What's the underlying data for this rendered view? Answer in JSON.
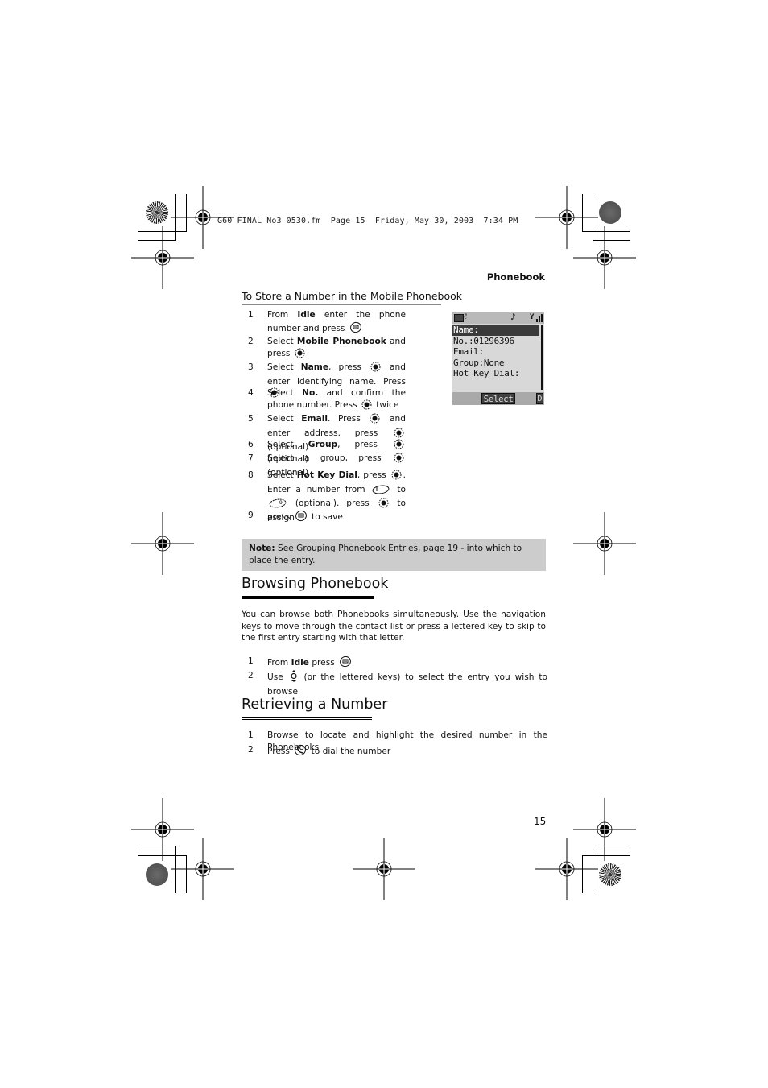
{
  "slug": "G60 FINAL No3 0530.fm  Page 15  Friday, May 30, 2003  7:34 PM",
  "running_head": "Phonebook",
  "store_section": {
    "title": "To Store a Number in the Mobile Phonebook",
    "steps": [
      {
        "num": "1",
        "parts": [
          {
            "t": "From "
          },
          {
            "b": "Idle"
          },
          {
            "t": " enter the phone number and press "
          },
          {
            "icon": "phonebook-key-icon"
          }
        ]
      },
      {
        "num": "2",
        "parts": [
          {
            "t": "Select "
          },
          {
            "b": "Mobile Phonebook"
          },
          {
            "t": " and press "
          },
          {
            "icon": "select-key-icon"
          }
        ]
      },
      {
        "num": "3",
        "parts": [
          {
            "t": "Select "
          },
          {
            "b": "Name"
          },
          {
            "t": ", press "
          },
          {
            "icon": "select-key-icon"
          },
          {
            "t": " and enter identifying name. Press "
          },
          {
            "icon": "select-key-icon"
          }
        ]
      },
      {
        "num": "4",
        "parts": [
          {
            "t": "Select "
          },
          {
            "b": "No."
          },
          {
            "t": " and confirm the phone number. Press "
          },
          {
            "icon": "select-key-icon"
          },
          {
            "t": " twice"
          }
        ]
      },
      {
        "num": "5",
        "parts": [
          {
            "t": "Select "
          },
          {
            "b": "Email"
          },
          {
            "t": ". Press "
          },
          {
            "icon": "select-key-icon"
          },
          {
            "t": " and enter address. press "
          },
          {
            "icon": "select-key-icon"
          },
          {
            "t": " (optional)"
          }
        ]
      },
      {
        "num": "6",
        "parts": [
          {
            "t": "Select "
          },
          {
            "b": "Group"
          },
          {
            "t": ", press "
          },
          {
            "icon": "select-key-icon"
          },
          {
            "t": " (optional)"
          }
        ]
      },
      {
        "num": "7",
        "parts": [
          {
            "t": "Select a group, press "
          },
          {
            "icon": "select-key-icon"
          },
          {
            "t": " (optional)"
          }
        ]
      },
      {
        "num": "8",
        "parts": [
          {
            "t": "Select "
          },
          {
            "b": "Hot Key Dial"
          },
          {
            "t": ", press "
          },
          {
            "icon": "select-key-icon"
          },
          {
            "t": ". Enter a number from "
          },
          {
            "icon": "key-1-icon"
          },
          {
            "t": " to "
          },
          {
            "icon": "key-9-icon"
          },
          {
            "t": " (optional). press "
          },
          {
            "icon": "select-key-icon"
          },
          {
            "t": " to assign"
          }
        ]
      },
      {
        "num": "9",
        "parts": [
          {
            "t": " press "
          },
          {
            "icon": "phonebook-key-icon"
          },
          {
            "t": " to save"
          }
        ]
      }
    ]
  },
  "phone_screen": {
    "status_icons": [
      "battery-icon",
      "line-1-icon",
      "music-note-icon",
      "signal-icon"
    ],
    "rows": [
      "Name:",
      "No.:01296396",
      "Email:",
      "Group:None",
      "Hot Key Dial:"
    ],
    "selected_row": 0,
    "softkey": "Select",
    "softkey_right": "D"
  },
  "note": {
    "label": "Note:",
    "text": " See Grouping Phonebook Entries, page 19 - into which to place the entry."
  },
  "browsing": {
    "title": "Browsing Phonebook",
    "paragraph": "You can browse both Phonebooks simultaneously. Use the navigation keys to move through the contact list or press a lettered key to skip to the first entry starting with that letter.",
    "steps": [
      {
        "num": "1",
        "parts": [
          {
            "t": "From "
          },
          {
            "b": "Idle"
          },
          {
            "t": " press "
          },
          {
            "icon": "phonebook-key-icon"
          }
        ]
      },
      {
        "num": "2",
        "parts": [
          {
            "t": "Use "
          },
          {
            "icon": "navigation-key-icon"
          },
          {
            "t": " (or the lettered keys) to select the entry you wish to browse"
          }
        ]
      }
    ]
  },
  "retrieving": {
    "title": "Retrieving a Number",
    "steps": [
      {
        "num": "1",
        "parts": [
          {
            "t": "Browse to locate and highlight the desired number in the Phonebooks"
          }
        ]
      },
      {
        "num": "2",
        "parts": [
          {
            "t": "Press "
          },
          {
            "icon": "call-key-icon"
          },
          {
            "t": " to dial the number"
          }
        ]
      }
    ]
  },
  "page_number": "15"
}
